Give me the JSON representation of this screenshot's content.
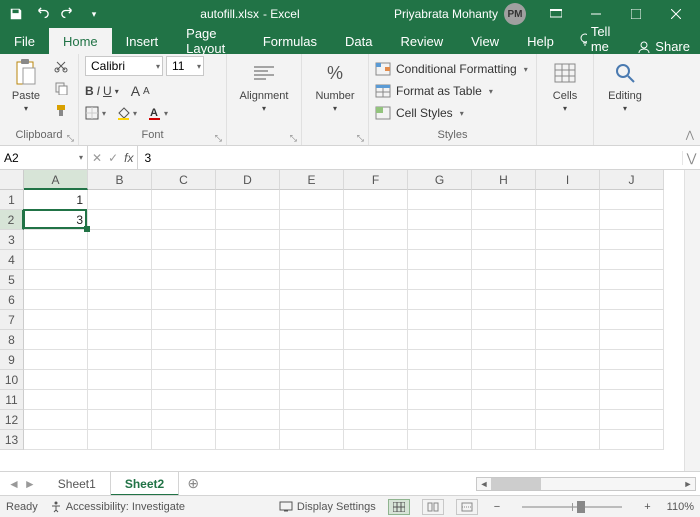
{
  "titlebar": {
    "filename": "autofill.xlsx",
    "app_suffix": " - Excel",
    "user_name": "Priyabrata Mohanty",
    "user_initials": "PM"
  },
  "tabs": {
    "file": "File",
    "home": "Home",
    "insert": "Insert",
    "page_layout": "Page Layout",
    "formulas": "Formulas",
    "data": "Data",
    "review": "Review",
    "view": "View",
    "help": "Help",
    "tell_me": "Tell me",
    "share": "Share"
  },
  "ribbon": {
    "clipboard": {
      "label": "Clipboard",
      "paste": "Paste"
    },
    "font": {
      "label": "Font",
      "name": "Calibri",
      "size": "11",
      "bold": "B",
      "italic": "I",
      "underline": "U",
      "grow": "A",
      "shrink": "A"
    },
    "alignment": {
      "label": "Alignment",
      "btn": "Alignment"
    },
    "number": {
      "label": "Number",
      "btn": "Number",
      "symbol": "%"
    },
    "styles": {
      "label": "Styles",
      "cond_format": "Conditional Formatting",
      "format_table": "Format as Table",
      "cell_styles": "Cell Styles"
    },
    "cells": {
      "label": "Cells",
      "btn": "Cells"
    },
    "editing": {
      "label": "Editing",
      "btn": "Editing"
    }
  },
  "formula_bar": {
    "name_box": "A2",
    "fx": "fx",
    "value": "3"
  },
  "grid": {
    "columns": [
      "A",
      "B",
      "C",
      "D",
      "E",
      "F",
      "G",
      "H",
      "I",
      "J"
    ],
    "rows": [
      "1",
      "2",
      "3",
      "4",
      "5",
      "6",
      "7",
      "8",
      "9",
      "10",
      "11",
      "12",
      "13"
    ],
    "active": "A2",
    "data": {
      "A1": "1",
      "A2": "3"
    }
  },
  "sheets": {
    "list": [
      "Sheet1",
      "Sheet2"
    ],
    "active": "Sheet2"
  },
  "status": {
    "ready": "Ready",
    "accessibility": "Accessibility: Investigate",
    "display_settings": "Display Settings",
    "zoom": "110%"
  }
}
